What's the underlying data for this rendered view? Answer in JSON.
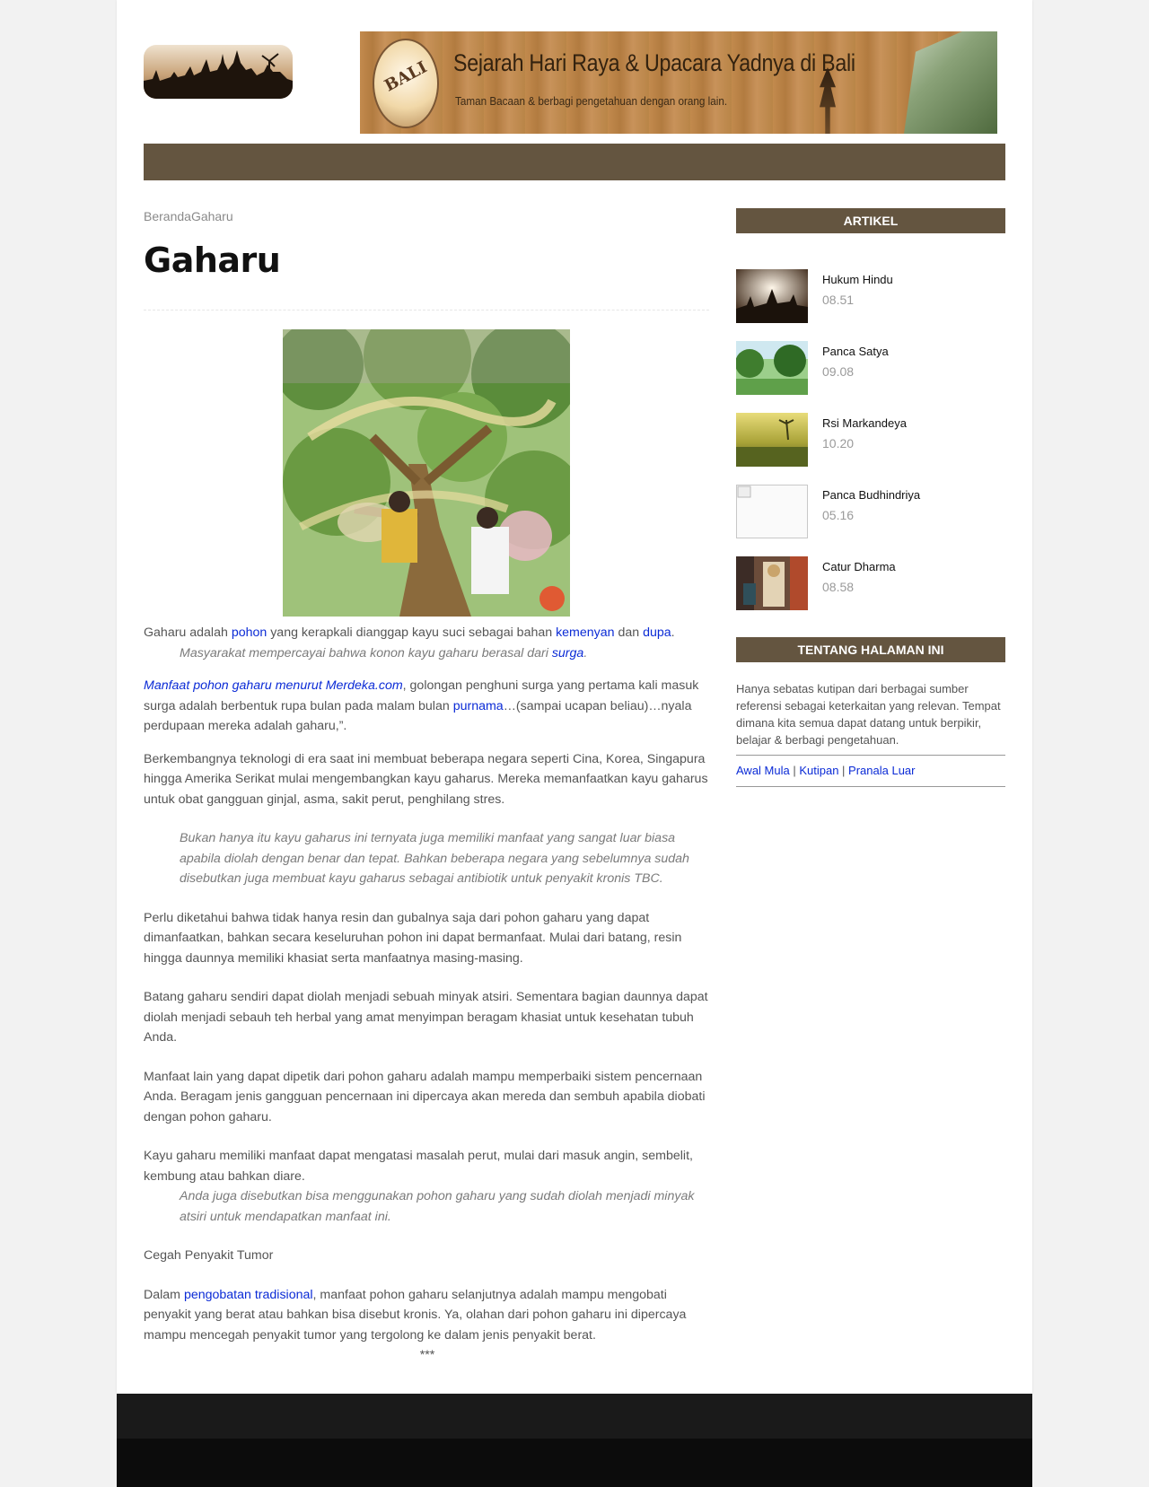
{
  "header": {
    "banner_logo_text": "BALI",
    "banner_title": "Sejarah Hari Raya & Upacara Yadnya di Bali",
    "banner_subtitle": "Taman Bacaan & berbagi pengetahuan dengan orang lain."
  },
  "breadcrumb": {
    "home": "Beranda",
    "current": "Gaharu"
  },
  "article": {
    "title": "Gaharu",
    "p1": {
      "t1": "Gaharu adalah ",
      "l1": "pohon",
      "t2": " yang kerapkali dianggap kayu suci sebagai bahan ",
      "l2": "kemenyan",
      "t3": " dan ",
      "l3": "dupa",
      "t4": "."
    },
    "q1": {
      "t1": "Masyarakat mempercayai bahwa konon kayu gaharu berasal dari ",
      "l1": "surga",
      "t2": "."
    },
    "p2": {
      "l1": "Manfaat pohon gaharu menurut Merdeka.com",
      "t1": ", golongan penghuni surga yang pertama kali masuk surga adalah berbentuk rupa bulan pada malam bulan ",
      "l2": "purnama",
      "t2": "…(sampai ucapan beliau)…nyala perdupaan mereka adalah gaharu,”."
    },
    "p3": "Berkembangnya teknologi di era saat ini membuat beberapa negara seperti Cina, Korea, Singapura hingga Amerika Serikat mulai mengembangkan kayu gaharus. Mereka memanfaatkan kayu gaharus untuk obat gangguan ginjal, asma, sakit perut, penghilang stres.",
    "q2": "Bukan hanya itu kayu gaharus ini ternyata juga memiliki manfaat yang sangat luar biasa apabila diolah dengan benar dan tepat. Bahkan beberapa negara yang sebelumnya sudah disebutkan juga membuat kayu gaharus sebagai antibiotik untuk penyakit kronis TBC.",
    "p4": "Perlu diketahui bahwa tidak hanya resin dan gubalnya saja dari pohon gaharu yang dapat dimanfaatkan, bahkan secara keseluruhan pohon ini dapat bermanfaat. Mulai dari batang, resin hingga daunnya memiliki khasiat serta manfaatnya masing-masing.",
    "p5": "Batang gaharu sendiri dapat diolah menjadi sebuah minyak atsiri. Sementara bagian daunnya dapat diolah menjadi sebauh teh herbal yang amat menyimpan beragam khasiat untuk kesehatan tubuh Anda.",
    "p6": "Manfaat lain yang dapat dipetik dari pohon gaharu adalah mampu memperbaiki sistem pencernaan Anda. Beragam jenis gangguan pencernaan ini dipercaya akan mereda dan sembuh apabila diobati dengan pohon gaharu.",
    "p7": "Kayu gaharu memiliki manfaat dapat mengatasi masalah perut, mulai dari masuk angin, sembelit, kembung atau bahkan diare.",
    "q3": "Anda juga disebutkan bisa menggunakan pohon gaharu yang sudah diolah menjadi minyak atsiri untuk mendapatkan manfaat ini.",
    "p8": "Cegah Penyakit Tumor",
    "p9": {
      "t1": "Dalam ",
      "l1": "pengobatan tradisional",
      "t2": ", manfaat pohon gaharu selanjutnya adalah mampu mengobati penyakit yang berat atau bahkan bisa disebut kronis. Ya, olahan dari pohon gaharu ini dipercaya mampu mencegah penyakit tumor yang tergolong ke dalam jenis penyakit berat."
    },
    "end": "***"
  },
  "sidebar": {
    "artikel_heading": "ARTIKEL",
    "posts": [
      {
        "title": "Hukum Hindu",
        "time": "08.51"
      },
      {
        "title": "Panca Satya",
        "time": "09.08"
      },
      {
        "title": "Rsi Markandeya",
        "time": "10.20"
      },
      {
        "title": "Panca Budhindriya",
        "time": "05.16"
      },
      {
        "title": "Catur Dharma",
        "time": "08.58"
      }
    ],
    "about_heading": "TENTANG HALAMAN INI",
    "about_text": "Hanya sebatas kutipan dari berbagai sumber referensi sebagai keterkaitan yang relevan. Tempat dimana kita semua dapat datang untuk berpikir, belajar & berbagi pengetahuan.",
    "links": [
      "Awal Mula",
      "Kutipan",
      "Pranala Luar"
    ],
    "link_sep": " | "
  }
}
